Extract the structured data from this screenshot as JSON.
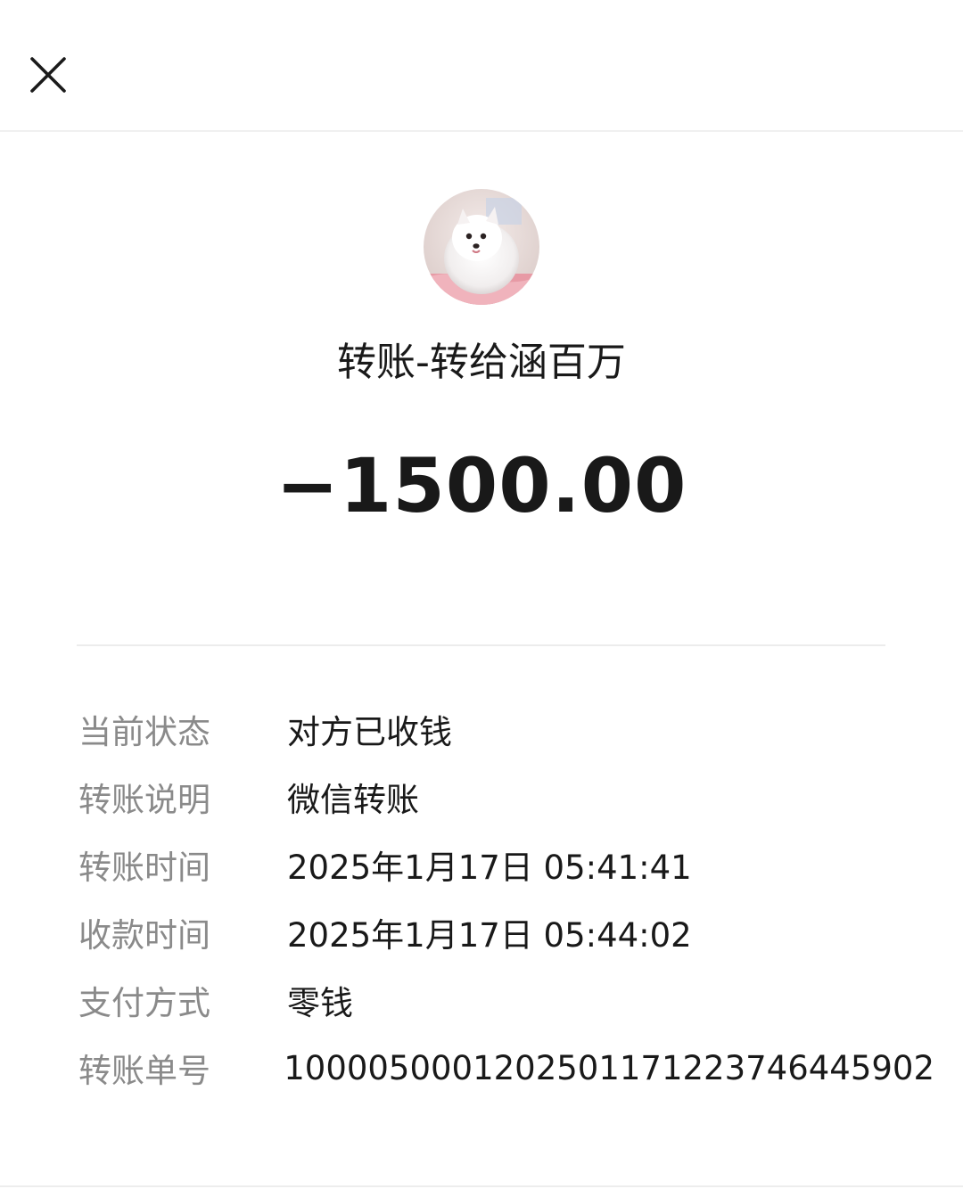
{
  "header": {
    "close_icon": "close-icon"
  },
  "recipient": {
    "avatar": "avatar-photo-white-dog"
  },
  "transfer": {
    "title": "转账-转给涵百万",
    "amount": "−1500.00"
  },
  "details": [
    {
      "label": "当前状态",
      "value": "对方已收钱"
    },
    {
      "label": "转账说明",
      "value": "微信转账"
    },
    {
      "label": "转账时间",
      "value": "2025年1月17日 05:41:41"
    },
    {
      "label": "收款时间",
      "value": "2025年1月17日 05:44:02"
    },
    {
      "label": "支付方式",
      "value": "零钱"
    },
    {
      "label": "转账单号",
      "value": "100005000120250117122374644590​2"
    }
  ],
  "colors": {
    "text_primary": "#191919",
    "text_secondary": "#8a8a8a",
    "divider": "#ececec",
    "background": "#ffffff"
  }
}
